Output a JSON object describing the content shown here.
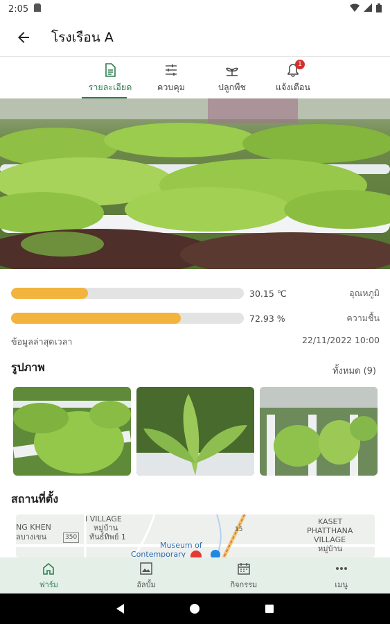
{
  "status_bar": {
    "time": "2:05"
  },
  "app_bar": {
    "title": "โรงเรือน A"
  },
  "tabs": [
    {
      "label": "รายละเอียด",
      "icon": "document-icon",
      "active": true
    },
    {
      "label": "ควบคุม",
      "icon": "sliders-icon",
      "active": false
    },
    {
      "label": "ปลูกพืช",
      "icon": "plant-icon",
      "active": false
    },
    {
      "label": "แจ้งเตือน",
      "icon": "bell-icon",
      "active": false,
      "badge": "1"
    }
  ],
  "readings": [
    {
      "value": "30.15 ℃",
      "label": "อุณหภูมิ",
      "fill_fraction": 0.33,
      "color": "#f2b43c"
    },
    {
      "value": "72.93 %",
      "label": "ความชื้น",
      "fill_fraction": 0.73,
      "color": "#f2b43c"
    }
  ],
  "last_update": {
    "label": "ข้อมูลล่าสุดเวลา",
    "timestamp": "22/11/2022 10:00"
  },
  "photos": {
    "title": "รูปภาพ",
    "all_label": "ทั้งหมด (9)"
  },
  "location": {
    "title": "สถานที่ตั้ง",
    "map_labels": {
      "a": "NG KHEN",
      "b": "ลบางเขน",
      "c": "I VILLAGE",
      "d": "หมู่บ้าน",
      "e": "ทันธ์ทิพย์ 1",
      "f": "Museum of",
      "g": "Contemporary",
      "h": "KASET",
      "i": "PHATTHANA",
      "j": "VILLAGE",
      "k": "หมู่บ้าน",
      "l": "350",
      "m": "15"
    }
  },
  "bottom_nav": [
    {
      "label": "ฟาร์ม",
      "icon": "home-icon",
      "active": true
    },
    {
      "label": "อัลบั้ม",
      "icon": "image-icon",
      "active": false
    },
    {
      "label": "กิจกรรม",
      "icon": "calendar-icon",
      "active": false
    },
    {
      "label": "เมนู",
      "icon": "more-icon",
      "active": false
    }
  ],
  "colors": {
    "accent": "#2e7d4f",
    "bar_fill": "#f2b43c",
    "nav_bg": "#e4efe7"
  }
}
